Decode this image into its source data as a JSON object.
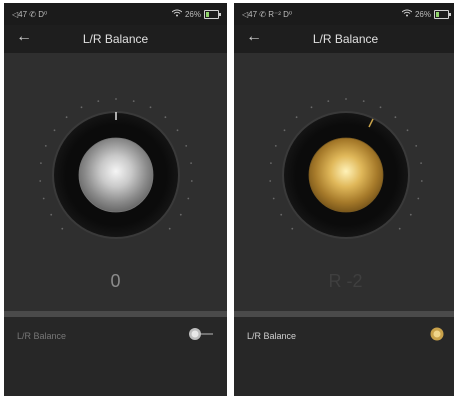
{
  "left": {
    "status": {
      "left_text": "◁47 ✆ D⁰",
      "battery_text": "26%"
    },
    "header": {
      "title": "L/R Balance",
      "back_icon": "back-arrow-icon"
    },
    "knob": {
      "finish": "silver",
      "indicator_color": "#e0e0e0",
      "value_text": "0"
    },
    "setting": {
      "label": "L/R Balance",
      "enabled": false
    }
  },
  "right": {
    "status": {
      "left_text": "◁47 ✆ R⁻² D⁰",
      "battery_text": "26%"
    },
    "header": {
      "title": "L/R Balance",
      "back_icon": "back-arrow-icon"
    },
    "knob": {
      "finish": "gold",
      "indicator_color": "#c8a24a",
      "value_text": "R -2"
    },
    "setting": {
      "label": "L/R Balance",
      "enabled": true
    }
  },
  "colors": {
    "gold": "#c9a24b",
    "silver": "#b8b8b8"
  }
}
